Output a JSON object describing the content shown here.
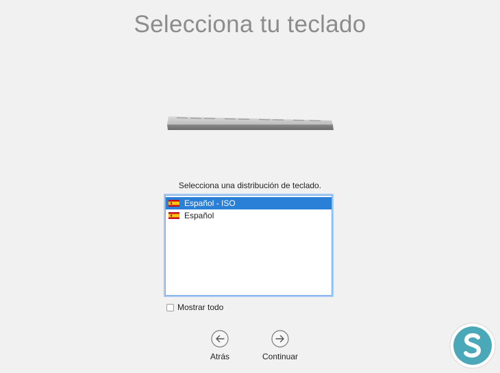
{
  "title": "Selecciona tu teclado",
  "prompt": "Selecciona una distribución de teclado.",
  "layouts": [
    {
      "label": "Español - ISO",
      "selected": true
    },
    {
      "label": "Español",
      "selected": false
    }
  ],
  "show_all": {
    "label": "Mostrar todo",
    "checked": false
  },
  "buttons": {
    "back": "Atrás",
    "continue": "Continuar"
  },
  "icons": {
    "keyboard": "keyboard-icon",
    "flag": "flag-spain-icon",
    "back": "arrow-left-circle-icon",
    "continue": "arrow-right-circle-icon",
    "watermark": "solvetic-logo"
  },
  "colors": {
    "background": "#f1f1f1",
    "title": "#8c8c8c",
    "selection": "#2a7fd6",
    "focus_ring": "#a8c9f1"
  }
}
